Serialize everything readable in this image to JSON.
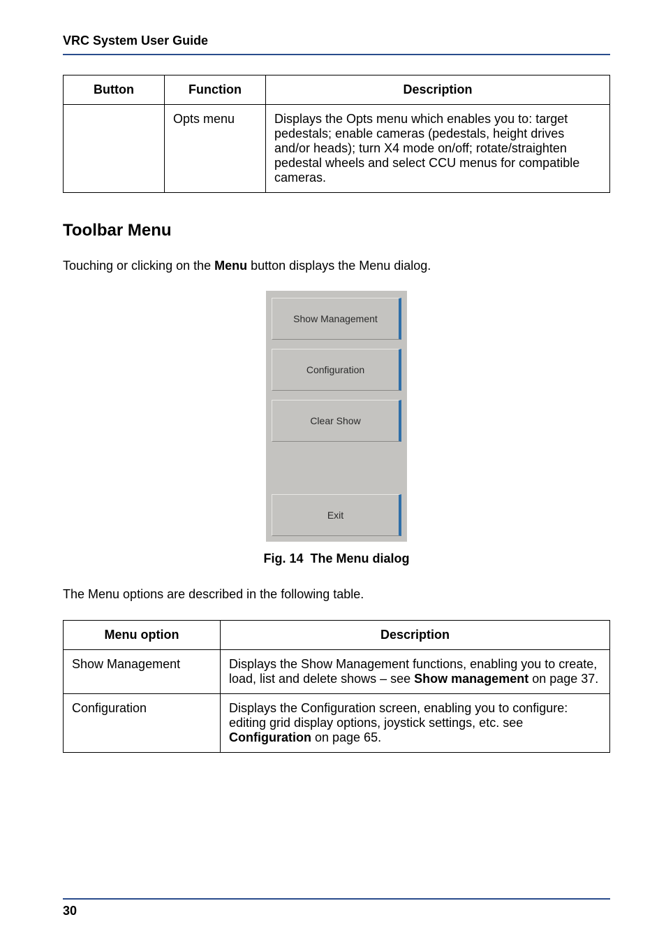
{
  "header": {
    "title": "VRC System User Guide"
  },
  "topTable": {
    "headers": {
      "button": "Button",
      "function": "Function",
      "description": "Description"
    },
    "row": {
      "button": "",
      "function": "Opts menu",
      "description": "Displays the Opts menu which enables you to: target pedestals; enable cameras (pedestals, height drives and/or heads); turn X4 mode on/off; rotate/straighten pedestal wheels and select CCU menus for compatible cameras."
    }
  },
  "sectionTitle": "Toolbar Menu",
  "intro": {
    "before": "Touching or clicking on the ",
    "bold": "Menu",
    "after": " button displays the Menu dialog."
  },
  "dialog": {
    "buttons": [
      "Show Management",
      "Configuration",
      "Clear Show",
      "Exit"
    ]
  },
  "figcap": {
    "prefix": "Fig. 14",
    "text": "The Menu dialog"
  },
  "menuIntro": "The Menu options are described in the following table.",
  "menuTable": {
    "headers": {
      "option": "Menu option",
      "description": "Description"
    },
    "rows": [
      {
        "option": "Show Management",
        "desc_before": "Displays the Show Management functions, enabling you to create, load, list and delete shows – see ",
        "desc_bold": "Show management",
        "desc_after": " on page 37."
      },
      {
        "option": "Configuration",
        "desc_before": "Displays the Configuration screen, enabling you to configure: editing grid display options, joystick settings, etc. see ",
        "desc_bold": "Configuration",
        "desc_after": " on page 65."
      }
    ]
  },
  "footer": {
    "page": "30"
  }
}
